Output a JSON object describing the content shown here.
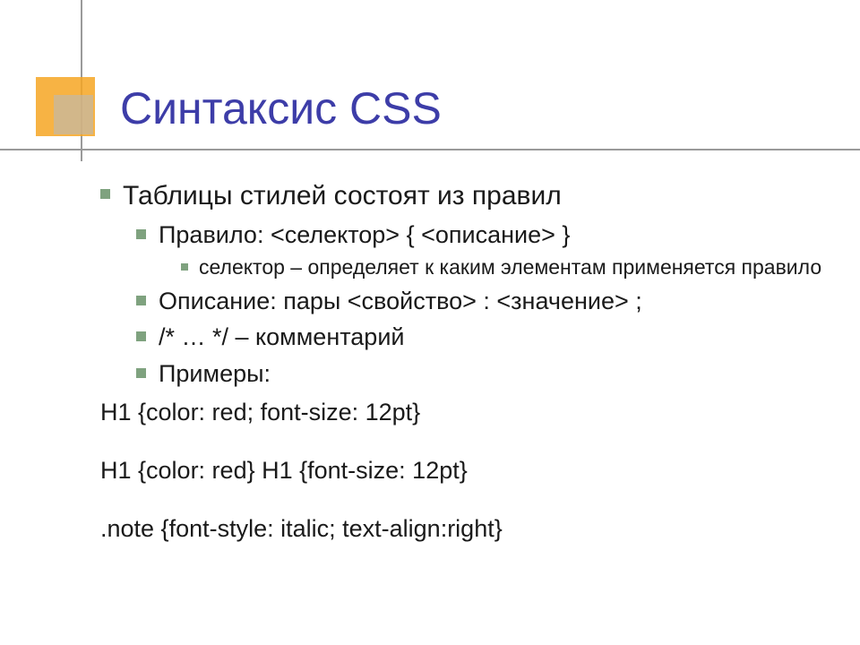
{
  "title": "Синтаксис CSS",
  "body": {
    "intro": "Таблицы стилей состоят из правил",
    "items": [
      "Правило: <селектор> { <описание> }",
      "Описание: пары <свойство> : <значение> ;",
      "/* … */ – комментарий",
      "Примеры:"
    ],
    "subitem": "селектор – определяет к каким элементам применяется правило",
    "examples": [
      "H1 {color: red; font-size: 12pt}",
      "H1 {color: red} H1 {font-size: 12pt}",
      ".note {font-style: italic; text-align:right}"
    ]
  }
}
